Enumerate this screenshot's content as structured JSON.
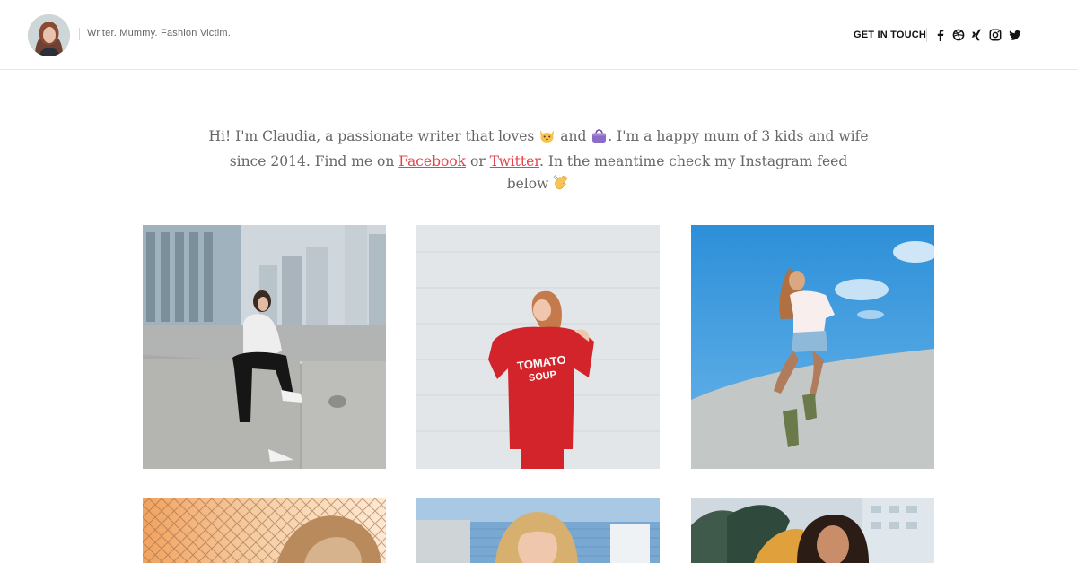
{
  "header": {
    "tagline": "Writer. Mummy. Fashion Victim.",
    "contact_label": "GET IN TOUCH",
    "social_icons": [
      "facebook-icon",
      "dribbble-icon",
      "xing-icon",
      "instagram-icon",
      "twitter-icon"
    ]
  },
  "intro": {
    "part1": "Hi! I'm Claudia, a passionate writer that loves ",
    "part2": " and ",
    "part3": ". I'm a happy mum of 3 kids and wife since 2014. Find me on ",
    "facebook_link": "Facebook",
    "part4": " or ",
    "twitter_link": "Twitter",
    "part5": ". In the meantime check my Instagram feed below ",
    "emojis": [
      "cat-emoji",
      "handbag-emoji",
      "wave-emoji"
    ],
    "link_color": "#e1444b"
  },
  "gallery": {
    "photos": [
      {
        "subject": "woman in white sweater sitting on concrete wall, city skyline"
      },
      {
        "subject": "woman in red TOMATO SOUP sweater against white wall",
        "shirt_text_1": "TOMATO",
        "shirt_text_2": "SOUP"
      },
      {
        "subject": "woman sitting on white wall under blue sky"
      },
      {
        "subject": "woman near chain-link fence at sunset"
      },
      {
        "subject": "blonde woman in front of blue building"
      },
      {
        "subject": "woman in yellow jacket among palm trees"
      }
    ]
  }
}
